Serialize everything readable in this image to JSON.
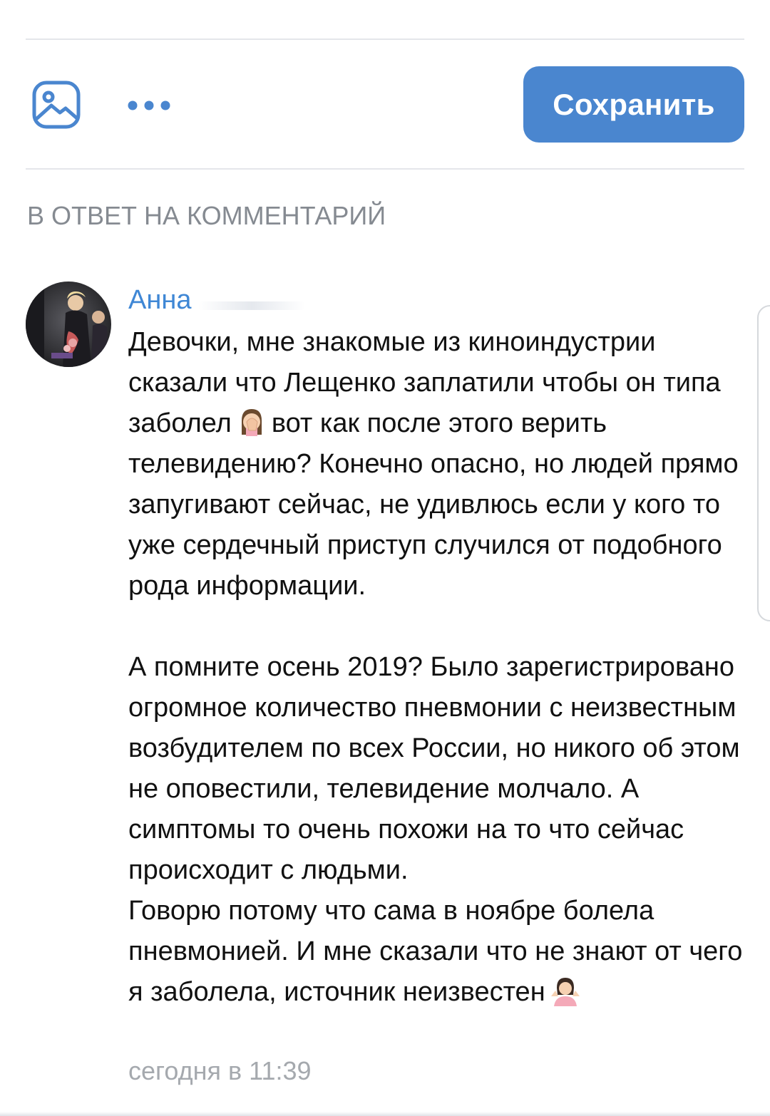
{
  "toolbar": {
    "photo_icon": "photo-icon",
    "more_icon": "more-dots-icon",
    "save_label": "Сохранить",
    "accent": "#4a86cf"
  },
  "reply_caption": "В ОТВЕТ НА КОММЕНТАРИЙ",
  "comment": {
    "author": "Анна",
    "paragraph_1_before_emoji": "Девочки, мне знакомые из киноиндустрии сказали что Лещенко заплатили чтобы он типа заболел",
    "paragraph_1_after_emoji": "вот как после этого верить телевидению? Конечно опасно, но людей прямо запугивают сейчас, не удивлюсь если у кого то уже сердечный приступ случился от подобного рода информации.",
    "paragraph_2": "А помните осень 2019? Было зарегистрировано огромное количество пневмонии с неизвестным возбудителем по всех России, но никого об этом не оповестили, телевидение молчало. А симптомы то очень похожи на то что сейчас происходит с людьми.",
    "paragraph_3": "Говорю потому что сама в ноябре болела пневмонией. И мне сказали что не знают от чего я заболела, источник неизвестен",
    "emoji_1": "facepalm-woman-emoji",
    "emoji_2": "shrug-woman-emoji",
    "timestamp": "сегодня в 11:39",
    "name_color": "#3f87d5"
  }
}
